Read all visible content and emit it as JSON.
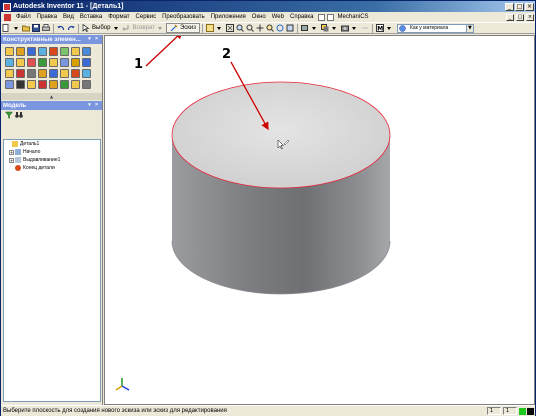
{
  "window": {
    "title": "Autodesk Inventor 11 - [Деталь1]",
    "buttons": [
      "_",
      "□",
      "×"
    ]
  },
  "menu": {
    "items": [
      "Файл",
      "Правка",
      "Вид",
      "Вставка",
      "Формат",
      "Сервис",
      "Преобразовать",
      "Приложения",
      "Окно",
      "Web",
      "Справка"
    ],
    "extra": "MechaniCS"
  },
  "toolbar": {
    "select_label": "Выбор",
    "return_label": "Возврат",
    "sketch_label": "Эскиз",
    "material_combo": "Как у материала"
  },
  "panels": {
    "features_title": "Конструктивные элемен...",
    "model_title": "Модель"
  },
  "tree": {
    "items": [
      {
        "label": "Деталь1",
        "level": 0,
        "expander": ""
      },
      {
        "label": "Начало",
        "level": 1,
        "expander": "+"
      },
      {
        "label": "Выдавливание1",
        "level": 1,
        "expander": "+"
      },
      {
        "label": "Конец детали",
        "level": 1,
        "expander": ""
      }
    ]
  },
  "annotations": {
    "one": "1",
    "two": "2"
  },
  "status": {
    "text": "Выберите плоскость для создания нового эскиза или эскиз для редактирования",
    "cell1": "1",
    "cell2": "1"
  },
  "colors": {
    "title_start": "#0a246a",
    "title_end": "#a6caf0",
    "panel_head": "#7a96df",
    "face_top": "#d9d9d9",
    "face_side": "#8d8e91",
    "edge_highlight": "#e8253a",
    "annotation": "#cc0000"
  }
}
